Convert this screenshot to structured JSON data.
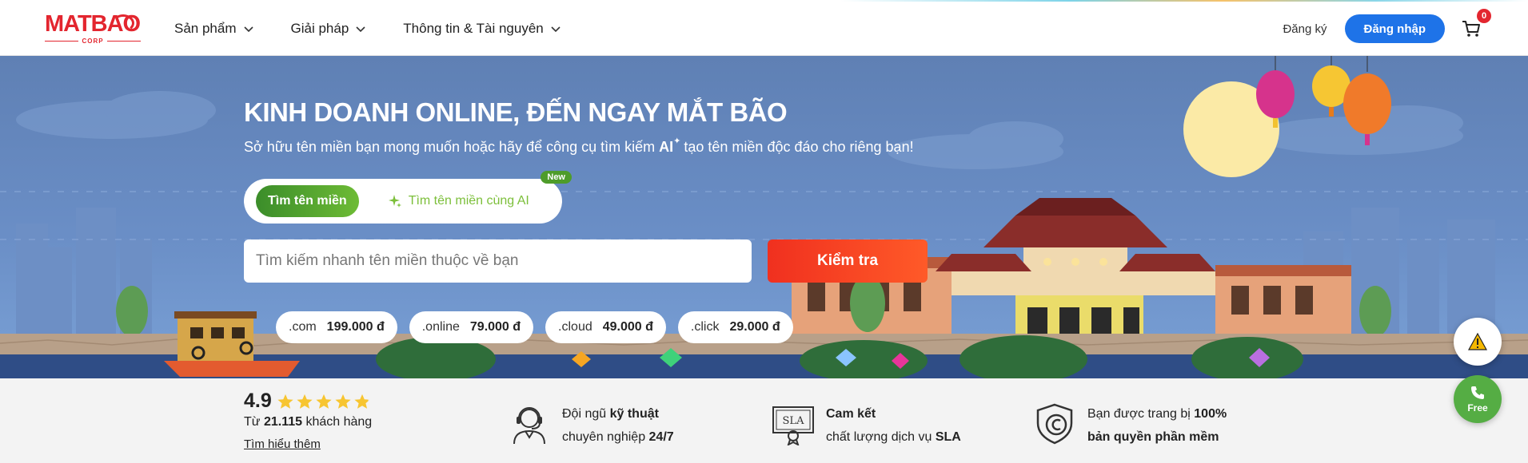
{
  "header": {
    "logo_text": "MATBAO",
    "logo_sub": "CORP",
    "nav": [
      {
        "label": "Sản phẩm"
      },
      {
        "label": "Giải pháp"
      },
      {
        "label": "Thông tin & Tài nguyên"
      }
    ],
    "register_label": "Đăng ký",
    "login_label": "Đăng nhập",
    "cart_count": "0"
  },
  "hero": {
    "title": "KINH DOANH ONLINE, ĐẾN NGAY MẮT BÃO",
    "subtitle_before": "Sở hữu tên miền bạn mong muốn hoặc hãy để công cụ tìm kiếm",
    "subtitle_ai": "AI",
    "subtitle_after": "tạo tên miền độc đáo cho riêng bạn!",
    "tab_domain": "Tìm tên miền",
    "tab_ai": "Tìm tên miền cùng AI",
    "tab_ai_badge": "New",
    "search_placeholder": "Tìm kiếm nhanh tên miền thuộc về bạn",
    "check_button": "Kiểm tra",
    "prices": [
      {
        "ext": ".com",
        "amount": "199.000 đ"
      },
      {
        "ext": ".online",
        "amount": "79.000 đ"
      },
      {
        "ext": ".cloud",
        "amount": "49.000 đ"
      },
      {
        "ext": ".click",
        "amount": "29.000 đ"
      }
    ]
  },
  "floating": {
    "call_label": "Free"
  },
  "features": {
    "rating_score": "4.9",
    "rating_fraction": 0.9,
    "rating_prefix": "Từ",
    "rating_count": "21.115",
    "rating_suffix": "khách hàng",
    "learn_more": "Tìm hiểu thêm",
    "items": [
      {
        "line1_plain": "Đội ngũ ",
        "line1_bold": "kỹ thuật",
        "line2_plain": "chuyên nghiệp ",
        "line2_bold": "24/7",
        "icon": "support-agent-icon"
      },
      {
        "line1_plain": "",
        "line1_bold": "Cam kết",
        "line2_plain": "chất lượng dịch vụ ",
        "line2_bold": "SLA",
        "icon": "sla-certificate-icon"
      },
      {
        "line1_plain": "Bạn được trang bị ",
        "line1_bold": "100%",
        "line2_plain": "",
        "line2_bold": "bản quyền phần mềm",
        "icon": "copyright-shield-icon"
      }
    ]
  },
  "colors": {
    "brand_red": "#e3262f",
    "login_blue": "#1e73e8",
    "ai_green": "#7cbf3a",
    "check_orange": "#ff5a28",
    "star_yellow": "#f7c531"
  }
}
